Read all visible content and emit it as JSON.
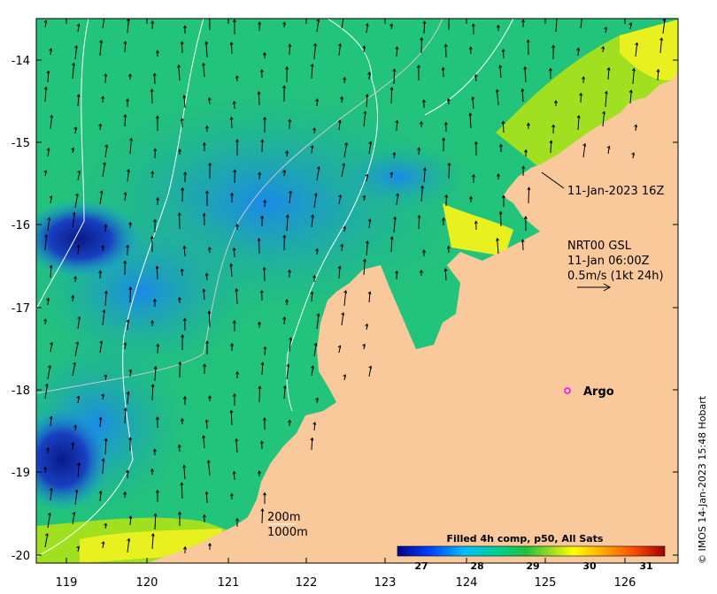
{
  "map": {
    "lon_ticks": [
      "119",
      "120",
      "121",
      "122",
      "123",
      "124",
      "125",
      "126"
    ],
    "lat_ticks": [
      "-14",
      "-15",
      "-16",
      "-17",
      "-18",
      "-19",
      "-20"
    ],
    "annotations": {
      "satellite_pass": "11-Jan-2023 16Z",
      "current_source": "NRT00 GSL",
      "current_time": "11-Jan 06:00Z",
      "current_scale": "0.5m/s (1kt 24h)",
      "argo": "Argo",
      "contour_200": "200m",
      "contour_1000": "1000m"
    },
    "colorbar": {
      "title": "Filled 4h comp, p50, All Sats",
      "ticks": [
        "27",
        "28",
        "29",
        "30",
        "31"
      ],
      "colors": [
        "#00008f",
        "#0040ff",
        "#00bfff",
        "#00d08a",
        "#20c040",
        "#a0e020",
        "#ffff00",
        "#ffb000",
        "#ff5000",
        "#a00000"
      ]
    },
    "credit": "© IMOS 14-Jan-2023 15:48 Hobart",
    "colors": {
      "land": "#f9c89b",
      "argo_marker": "#ff00ff",
      "ocean_green": "#22c37a",
      "ocean_blue": "#1aa6ee",
      "ocean_deep": "#0a1a8a",
      "warm_yellow": "#e8f020"
    }
  }
}
